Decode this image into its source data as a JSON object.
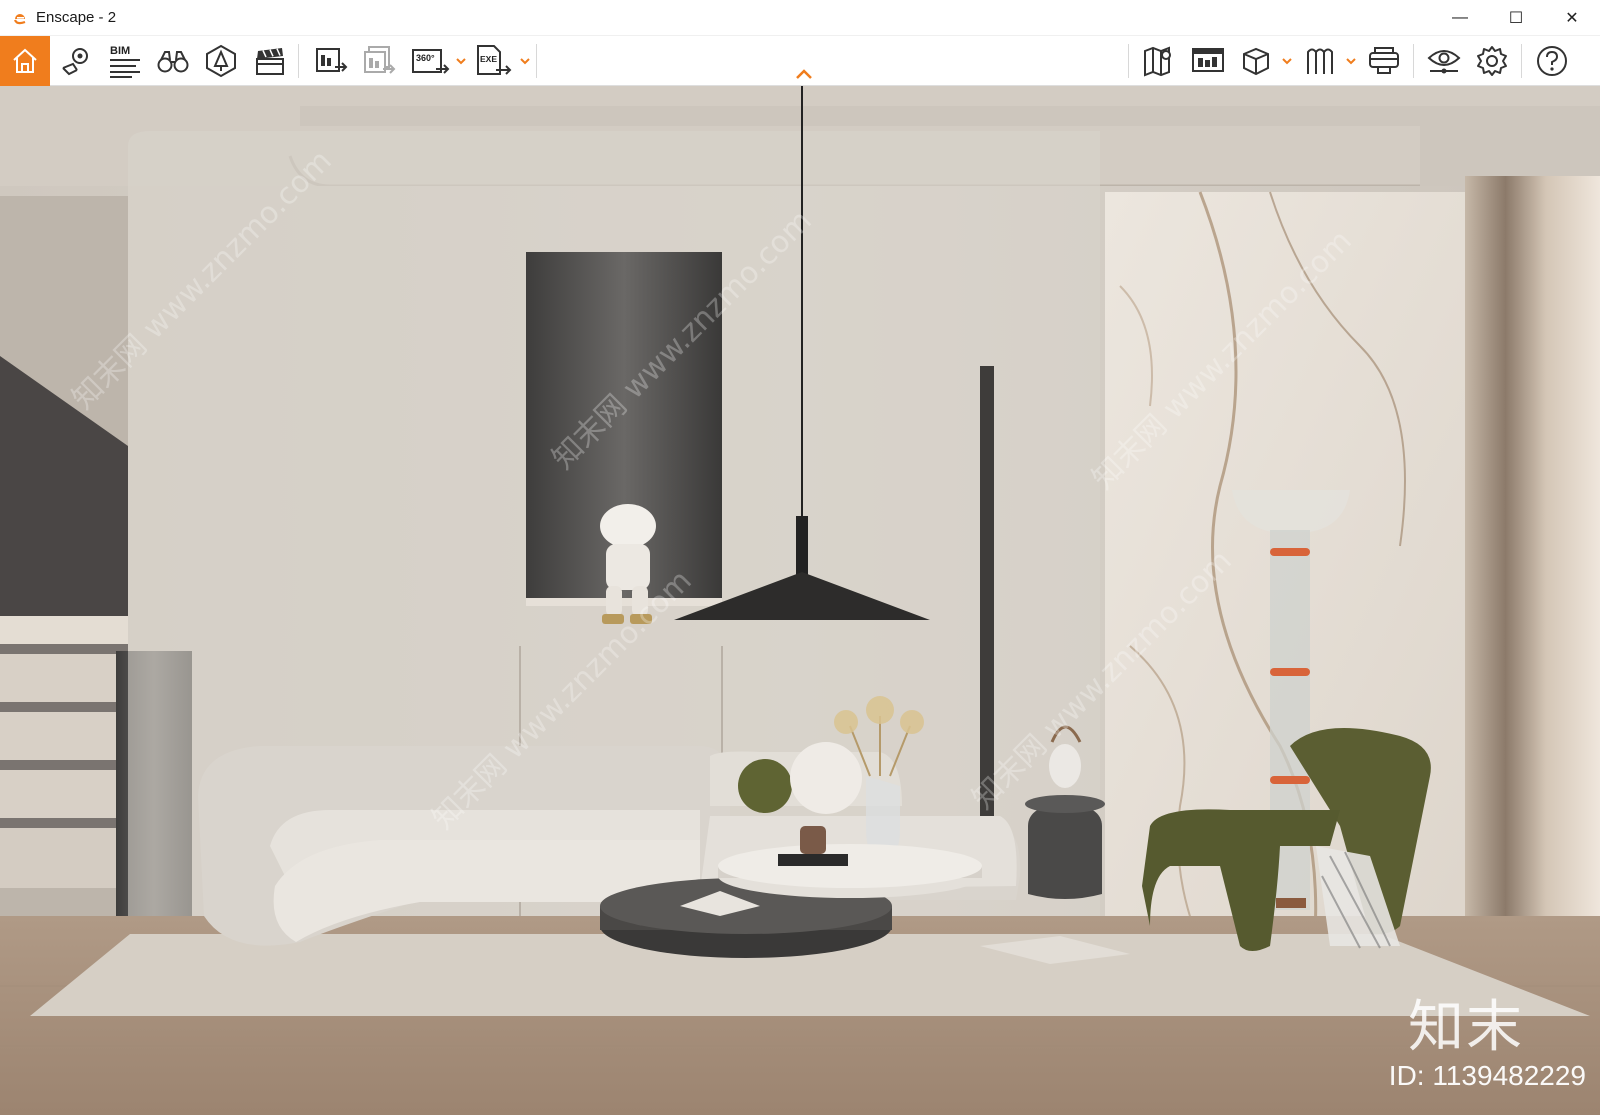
{
  "window": {
    "title": "Enscape - 2",
    "controls": {
      "minimize": "—",
      "maximize": "☐",
      "close": "✕"
    }
  },
  "toolbar": {
    "accent_color": "#f07d1d",
    "left_tools": [
      {
        "name": "home-icon",
        "label": ""
      },
      {
        "name": "bookmark-pin-icon",
        "label": ""
      },
      {
        "name": "bim-icon",
        "label": "BIM"
      },
      {
        "name": "binoculars-icon",
        "label": ""
      },
      {
        "name": "asset-library-icon",
        "label": ""
      },
      {
        "name": "video-editor-icon",
        "label": ""
      },
      {
        "name": "export-image-icon",
        "label": ""
      },
      {
        "name": "batch-render-icon",
        "label": ""
      },
      {
        "name": "export-panorama-icon",
        "label": "360°"
      },
      {
        "name": "export-exe-icon",
        "label": "EXE"
      }
    ],
    "right_tools": [
      {
        "name": "map-icon"
      },
      {
        "name": "upload-icon"
      },
      {
        "name": "cube-view-icon"
      },
      {
        "name": "bookmarks-icon"
      },
      {
        "name": "vr-headset-icon"
      },
      {
        "name": "visual-settings-icon"
      },
      {
        "name": "settings-gear-icon"
      },
      {
        "name": "help-icon"
      }
    ]
  },
  "viewport": {
    "brand_mark": "知末",
    "image_id": "ID: 1139482229",
    "watermark": "知末网 www.znzmo.com"
  }
}
